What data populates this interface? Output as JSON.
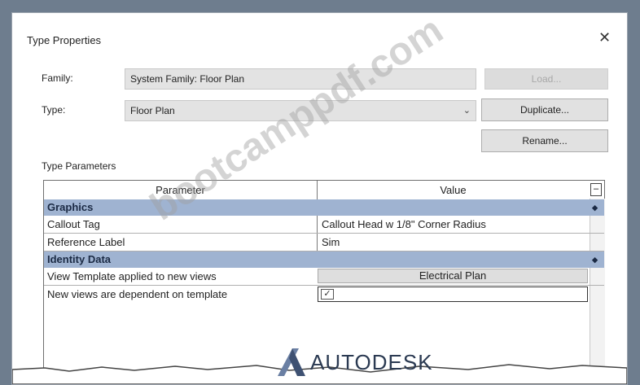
{
  "dialog": {
    "title": "Type Properties",
    "family_label": "Family:",
    "family_value": "System Family: Floor Plan",
    "type_label": "Type:",
    "type_value": "Floor Plan",
    "load_label": "Load...",
    "duplicate_label": "Duplicate...",
    "rename_label": "Rename..."
  },
  "type_parameters": {
    "section_title": "Type Parameters",
    "columns": [
      "Parameter",
      "Value"
    ],
    "groups": [
      {
        "name": "Graphics",
        "rows": [
          {
            "parameter": "Callout Tag",
            "value": "Callout Head w 1/8\" Corner Radius"
          },
          {
            "parameter": "Reference Label",
            "value": "Sim"
          }
        ]
      },
      {
        "name": "Identity Data",
        "rows": [
          {
            "parameter": "View Template applied to new views",
            "value": "Electrical Plan"
          },
          {
            "parameter": "New views are dependent on template",
            "checked": true
          }
        ]
      }
    ]
  },
  "watermark": "bootcamppdf.com",
  "logo": {
    "text": "AUTODESK",
    "color": "#2b3a52"
  },
  "colors": {
    "group_header": "#9fb3d1",
    "background": "#6e7d8e"
  }
}
